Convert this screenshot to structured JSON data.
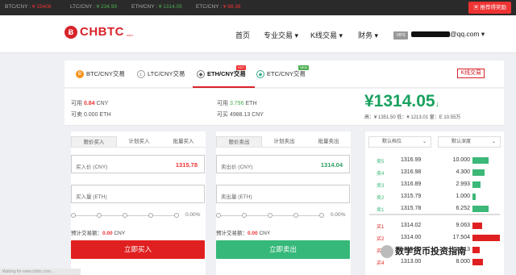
{
  "ticker": {
    "items": [
      {
        "pair": "BTC/CNY :",
        "price": "¥ 15408"
      },
      {
        "pair": "LTC/CNY :",
        "price": "¥ 234.99"
      },
      {
        "pair": "ETH/CNY :",
        "price": "¥ 1314.05"
      },
      {
        "pair": "ETC/CNY :",
        "price": "¥ 88.38"
      }
    ],
    "gift_label": "推荐得奖励",
    "colors": {
      "down": "#e33333",
      "up": "#4caf50"
    }
  },
  "header": {
    "logo_text": "CHBTC",
    "logo_mark": "Ƀ",
    "logo_suffix": ".com",
    "nav": [
      "首页",
      "专业交易 ▾",
      "K线交易 ▾",
      "财务 ▾"
    ],
    "vip": "VIP3",
    "user_suffix": "@qq.com ▾"
  },
  "coin_tabs": [
    {
      "label": "BTC/CNY交易",
      "icon": "bitcoin-icon",
      "badge": ""
    },
    {
      "label": "LTC/CNY交易",
      "icon": "litecoin-icon",
      "badge": ""
    },
    {
      "label": "ETH/CNY交易",
      "icon": "ethereum-icon",
      "badge": "HOT"
    },
    {
      "label": "ETC/CNY交易",
      "icon": "ethereum-classic-icon",
      "badge": "NEW"
    }
  ],
  "kline_link": "K线交易",
  "balances": {
    "avail_cny_label": "可用",
    "avail_cny": "0.84",
    "avail_cny_unit": "CNY",
    "frozen_eth_label": "可卖",
    "frozen_eth": "0.000 ETH",
    "avail_eth_label": "可用",
    "avail_eth": "3.796",
    "avail_eth_unit": "ETH",
    "buyable_label": "可买",
    "buyable": "4988.13 CNY"
  },
  "price": {
    "current": "¥1314.05",
    "arrow": "↓",
    "stats": "高：¥ 1351.50    低：¥ 1213.01    量：E 10.55万"
  },
  "buy_panel": {
    "tabs": [
      "限价买入",
      "计划买入",
      "批量买入"
    ],
    "price_label": "买入价 (CNY)",
    "price_value": "1315.78",
    "amount_label": "买入量 (ETH)",
    "percent": "0.00%",
    "estimate_label": "预计交易额：",
    "estimate_value": "0.00",
    "estimate_unit": "CNY",
    "button": "立即买入",
    "color": "#e02020"
  },
  "sell_panel": {
    "tabs": [
      "限价卖出",
      "计划卖出",
      "批量卖出"
    ],
    "price_label": "卖出价 (CNY)",
    "price_value": "1314.04",
    "amount_label": "卖出量 (ETH)",
    "percent": "0.00%",
    "estimate_label": "预计交易额：",
    "estimate_value": "0.00",
    "estimate_unit": "CNY",
    "button": "立即卖出",
    "color": "#35b87a"
  },
  "order_book": {
    "sel_left": "默认档位",
    "sel_right": "默认深度",
    "asks": [
      {
        "label": "卖5",
        "price": "1316.99",
        "qty": "10.000",
        "fill": 0.56
      },
      {
        "label": "卖4",
        "price": "1316.98",
        "qty": "4.300",
        "fill": 0.42
      },
      {
        "label": "卖3",
        "price": "1316.89",
        "qty": "2.993",
        "fill": 0.28
      },
      {
        "label": "卖2",
        "price": "1315.79",
        "qty": "1.000",
        "fill": 0.1
      },
      {
        "label": "卖1",
        "price": "1315.78",
        "qty": "6.252",
        "fill": 0.55
      }
    ],
    "bids": [
      {
        "label": "买1",
        "price": "1314.02",
        "qty": "9.063",
        "fill": 0.33
      },
      {
        "label": "买2",
        "price": "1314.00",
        "qty": "17.504",
        "fill": 0.95
      },
      {
        "label": "买3",
        "price": "1313.20",
        "qty": "2.413",
        "fill": 0.25
      },
      {
        "label": "买4",
        "price": "1313.00",
        "qty": "8.000",
        "fill": 0.35
      }
    ],
    "ask_color": "#3cb878",
    "bid_color": "#e02020"
  },
  "watermark": "数学货币投资指南",
  "status_text": "Waiting for www.chbtc.com..."
}
